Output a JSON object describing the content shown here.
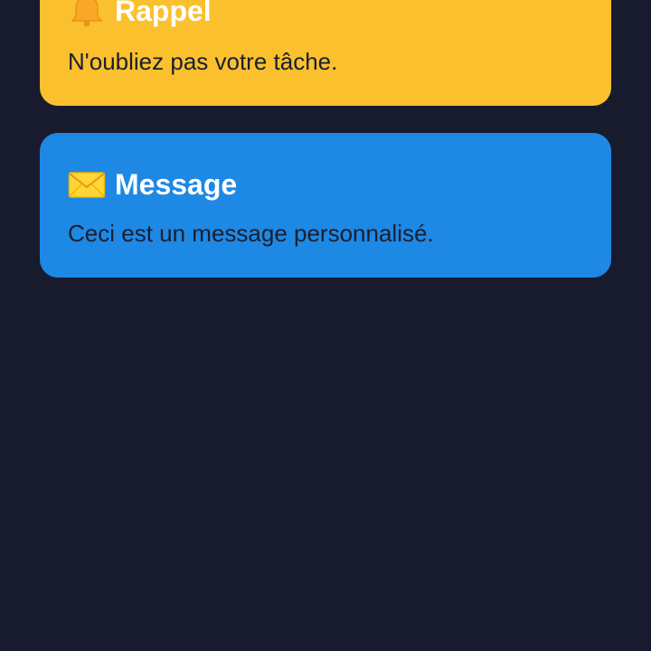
{
  "colors": {
    "background": "#181a2e",
    "reminder_card": "#fbc02d",
    "message_card": "#1e88e5",
    "title_text": "#ffffff",
    "body_text": "#1a1f2e"
  },
  "cards": [
    {
      "icon": "bell-icon",
      "title": "Rappel",
      "body": "N'oubliez pas votre tâche."
    },
    {
      "icon": "envelope-icon",
      "title": "Message",
      "body": "Ceci est un message personnalisé."
    }
  ]
}
